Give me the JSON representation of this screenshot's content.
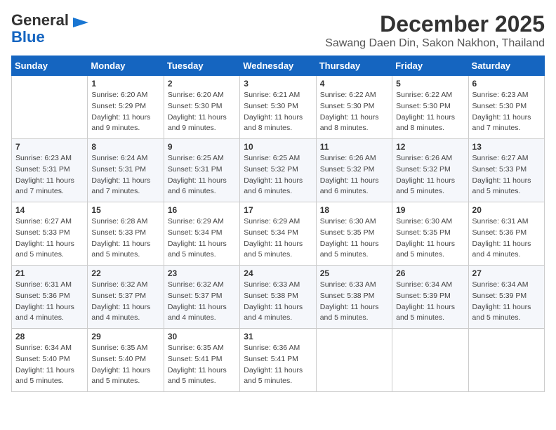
{
  "header": {
    "logo_line1": "General",
    "logo_line2": "Blue",
    "title": "December 2025",
    "subtitle": "Sawang Daen Din, Sakon Nakhon, Thailand"
  },
  "days_of_week": [
    "Sunday",
    "Monday",
    "Tuesday",
    "Wednesday",
    "Thursday",
    "Friday",
    "Saturday"
  ],
  "weeks": [
    [
      {
        "day": "",
        "sunrise": "",
        "sunset": "",
        "daylight": ""
      },
      {
        "day": "1",
        "sunrise": "6:20 AM",
        "sunset": "5:29 PM",
        "daylight": "11 hours and 9 minutes."
      },
      {
        "day": "2",
        "sunrise": "6:20 AM",
        "sunset": "5:30 PM",
        "daylight": "11 hours and 9 minutes."
      },
      {
        "day": "3",
        "sunrise": "6:21 AM",
        "sunset": "5:30 PM",
        "daylight": "11 hours and 8 minutes."
      },
      {
        "day": "4",
        "sunrise": "6:22 AM",
        "sunset": "5:30 PM",
        "daylight": "11 hours and 8 minutes."
      },
      {
        "day": "5",
        "sunrise": "6:22 AM",
        "sunset": "5:30 PM",
        "daylight": "11 hours and 8 minutes."
      },
      {
        "day": "6",
        "sunrise": "6:23 AM",
        "sunset": "5:30 PM",
        "daylight": "11 hours and 7 minutes."
      }
    ],
    [
      {
        "day": "7",
        "sunrise": "6:23 AM",
        "sunset": "5:31 PM",
        "daylight": "11 hours and 7 minutes."
      },
      {
        "day": "8",
        "sunrise": "6:24 AM",
        "sunset": "5:31 PM",
        "daylight": "11 hours and 7 minutes."
      },
      {
        "day": "9",
        "sunrise": "6:25 AM",
        "sunset": "5:31 PM",
        "daylight": "11 hours and 6 minutes."
      },
      {
        "day": "10",
        "sunrise": "6:25 AM",
        "sunset": "5:32 PM",
        "daylight": "11 hours and 6 minutes."
      },
      {
        "day": "11",
        "sunrise": "6:26 AM",
        "sunset": "5:32 PM",
        "daylight": "11 hours and 6 minutes."
      },
      {
        "day": "12",
        "sunrise": "6:26 AM",
        "sunset": "5:32 PM",
        "daylight": "11 hours and 5 minutes."
      },
      {
        "day": "13",
        "sunrise": "6:27 AM",
        "sunset": "5:33 PM",
        "daylight": "11 hours and 5 minutes."
      }
    ],
    [
      {
        "day": "14",
        "sunrise": "6:27 AM",
        "sunset": "5:33 PM",
        "daylight": "11 hours and 5 minutes."
      },
      {
        "day": "15",
        "sunrise": "6:28 AM",
        "sunset": "5:33 PM",
        "daylight": "11 hours and 5 minutes."
      },
      {
        "day": "16",
        "sunrise": "6:29 AM",
        "sunset": "5:34 PM",
        "daylight": "11 hours and 5 minutes."
      },
      {
        "day": "17",
        "sunrise": "6:29 AM",
        "sunset": "5:34 PM",
        "daylight": "11 hours and 5 minutes."
      },
      {
        "day": "18",
        "sunrise": "6:30 AM",
        "sunset": "5:35 PM",
        "daylight": "11 hours and 5 minutes."
      },
      {
        "day": "19",
        "sunrise": "6:30 AM",
        "sunset": "5:35 PM",
        "daylight": "11 hours and 5 minutes."
      },
      {
        "day": "20",
        "sunrise": "6:31 AM",
        "sunset": "5:36 PM",
        "daylight": "11 hours and 4 minutes."
      }
    ],
    [
      {
        "day": "21",
        "sunrise": "6:31 AM",
        "sunset": "5:36 PM",
        "daylight": "11 hours and 4 minutes."
      },
      {
        "day": "22",
        "sunrise": "6:32 AM",
        "sunset": "5:37 PM",
        "daylight": "11 hours and 4 minutes."
      },
      {
        "day": "23",
        "sunrise": "6:32 AM",
        "sunset": "5:37 PM",
        "daylight": "11 hours and 4 minutes."
      },
      {
        "day": "24",
        "sunrise": "6:33 AM",
        "sunset": "5:38 PM",
        "daylight": "11 hours and 4 minutes."
      },
      {
        "day": "25",
        "sunrise": "6:33 AM",
        "sunset": "5:38 PM",
        "daylight": "11 hours and 5 minutes."
      },
      {
        "day": "26",
        "sunrise": "6:34 AM",
        "sunset": "5:39 PM",
        "daylight": "11 hours and 5 minutes."
      },
      {
        "day": "27",
        "sunrise": "6:34 AM",
        "sunset": "5:39 PM",
        "daylight": "11 hours and 5 minutes."
      }
    ],
    [
      {
        "day": "28",
        "sunrise": "6:34 AM",
        "sunset": "5:40 PM",
        "daylight": "11 hours and 5 minutes."
      },
      {
        "day": "29",
        "sunrise": "6:35 AM",
        "sunset": "5:40 PM",
        "daylight": "11 hours and 5 minutes."
      },
      {
        "day": "30",
        "sunrise": "6:35 AM",
        "sunset": "5:41 PM",
        "daylight": "11 hours and 5 minutes."
      },
      {
        "day": "31",
        "sunrise": "6:36 AM",
        "sunset": "5:41 PM",
        "daylight": "11 hours and 5 minutes."
      },
      {
        "day": "",
        "sunrise": "",
        "sunset": "",
        "daylight": ""
      },
      {
        "day": "",
        "sunrise": "",
        "sunset": "",
        "daylight": ""
      },
      {
        "day": "",
        "sunrise": "",
        "sunset": "",
        "daylight": ""
      }
    ]
  ],
  "labels": {
    "sunrise_prefix": "Sunrise: ",
    "sunset_prefix": "Sunset: ",
    "daylight_prefix": "Daylight: "
  }
}
